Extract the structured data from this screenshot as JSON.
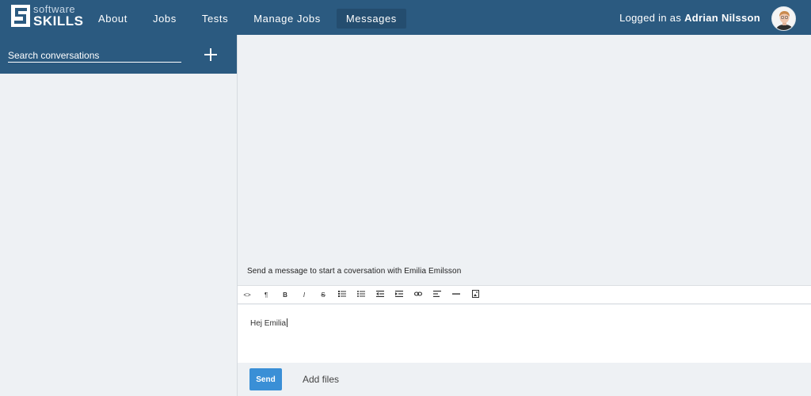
{
  "brand": {
    "top": "software",
    "bottom": "SKILLS",
    "color": "#2b5a80"
  },
  "nav": {
    "items": [
      {
        "label": "About"
      },
      {
        "label": "Jobs"
      },
      {
        "label": "Tests"
      },
      {
        "label": "Manage Jobs"
      },
      {
        "label": "Messages",
        "active": true
      }
    ]
  },
  "user": {
    "prefix": "Logged in as",
    "name": "Adrian Nilsson",
    "avatar_icon": "user-avatar"
  },
  "sidebar": {
    "search_placeholder": "Search conversations",
    "add_icon": "plus-icon"
  },
  "conversation": {
    "hint": "Send a message to start a coversation with Emilia Emilsson"
  },
  "editor": {
    "toolbar_icons": [
      "code-view-icon",
      "paragraph-icon",
      "bold-icon",
      "italic-icon",
      "strikethrough-icon",
      "ordered-list-icon",
      "unordered-list-icon",
      "outdent-icon",
      "indent-icon",
      "link-icon",
      "align-left-icon",
      "horizontal-rule-icon",
      "insert-image-icon"
    ],
    "text": "Hej Emilia"
  },
  "actions": {
    "send_label": "Send",
    "add_files_label": "Add files",
    "send_color": "#3a8fd6"
  }
}
